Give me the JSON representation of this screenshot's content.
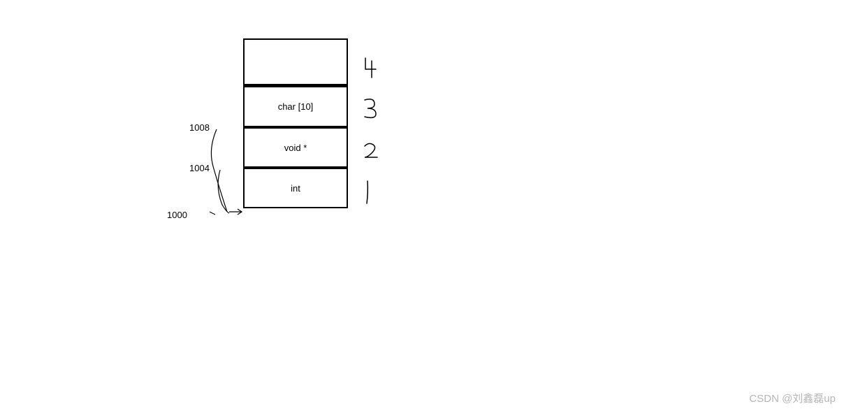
{
  "diagram": {
    "cells": {
      "cell4_label": "",
      "cell3_label": "char [10]",
      "cell2_label": "void *",
      "cell1_label": "int"
    },
    "addresses": {
      "addr_1008": "1008",
      "addr_1004": "1004",
      "addr_1000": "1000"
    },
    "handwritten": {
      "num4": "4",
      "num3": "3",
      "num2": "2",
      "num1": "1"
    }
  },
  "watermark": "CSDN @刘鑫磊up"
}
